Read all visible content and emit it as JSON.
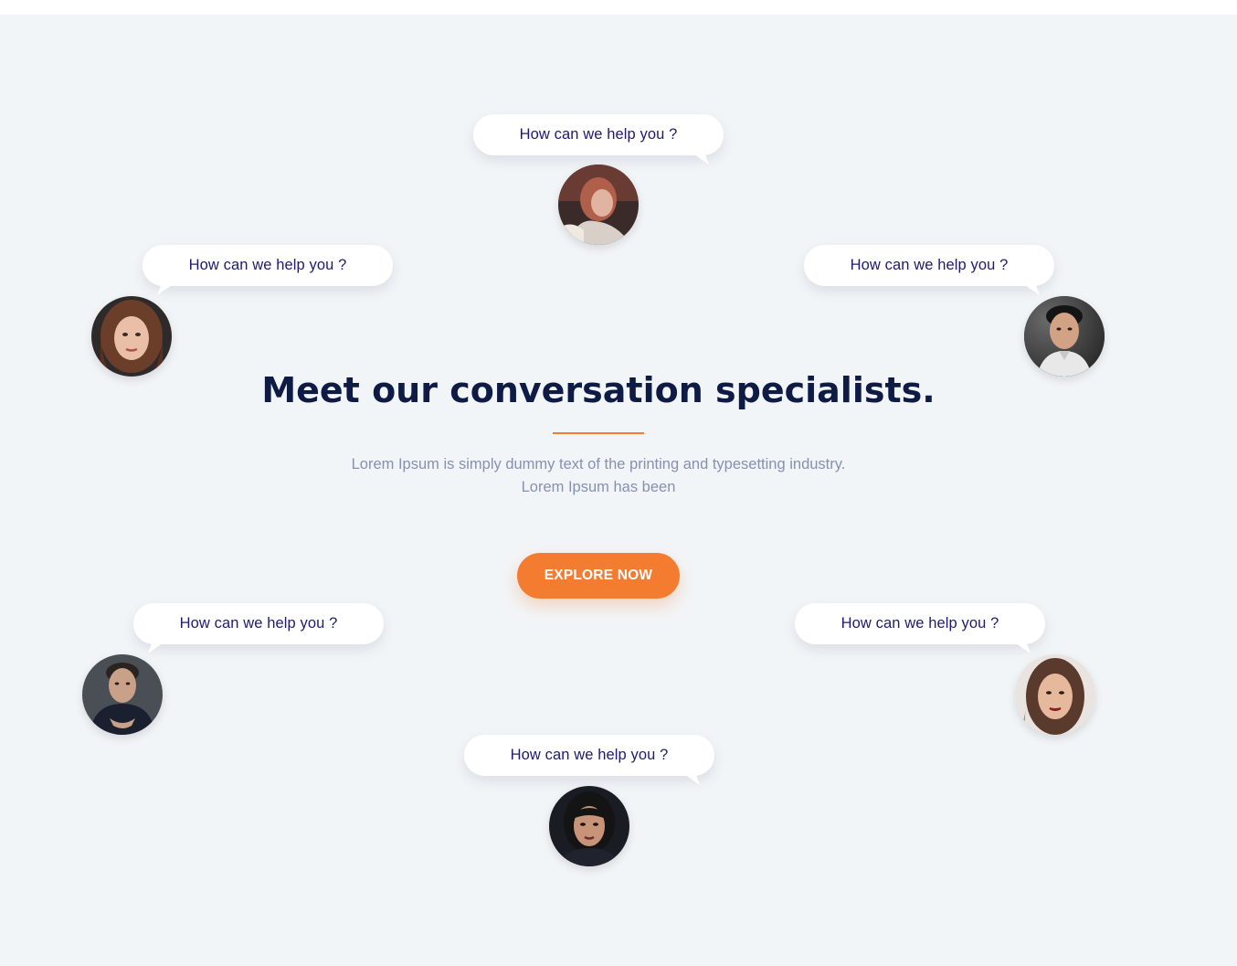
{
  "section": {
    "heading": "Meet our conversation specialists.",
    "description": "Lorem Ipsum is simply dummy text of the printing and typesetting industry. Lorem Ipsum has been",
    "cta_label": "EXPLORE NOW"
  },
  "specialists": [
    {
      "bubble_text": "How can we help you ?"
    },
    {
      "bubble_text": "How can we help you ?"
    },
    {
      "bubble_text": "How can we help you ?"
    },
    {
      "bubble_text": "How can we help you ?"
    },
    {
      "bubble_text": "How can we help you ?"
    },
    {
      "bubble_text": "How can we help you ?"
    }
  ],
  "colors": {
    "background": "#f2f5f8",
    "heading": "#0e1b45",
    "accent": "#f47c30",
    "bubble_text": "#1e1a6e",
    "description": "#8790ad"
  }
}
